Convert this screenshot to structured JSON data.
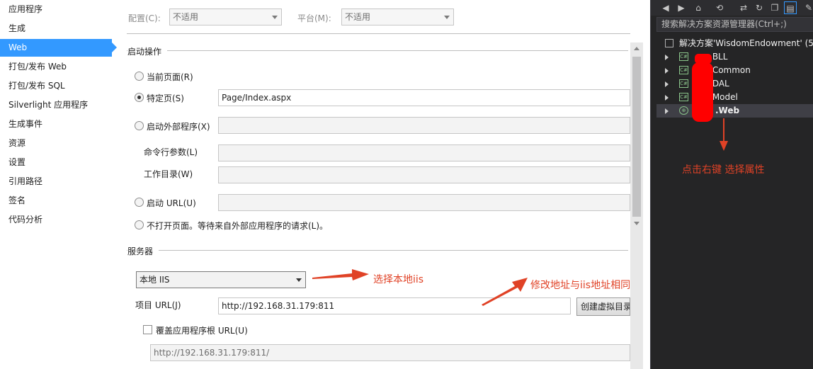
{
  "nav": {
    "items": [
      "应用程序",
      "生成",
      "Web",
      "打包/发布 Web",
      "打包/发布 SQL",
      "Silverlight 应用程序",
      "生成事件",
      "资源",
      "设置",
      "引用路径",
      "签名",
      "代码分析"
    ],
    "active_index": 2
  },
  "config_bar": {
    "config_label": "配置(C):",
    "config_value": "不适用",
    "platform_label": "平台(M):",
    "platform_value": "不适用"
  },
  "start_action": {
    "title": "启动操作",
    "current_page_label": "当前页面(R)",
    "specific_page_label": "特定页(S)",
    "specific_page_value": "Page/Index.aspx",
    "external_program_label": "启动外部程序(X)",
    "cmd_args_label": "命令行参数(L)",
    "working_dir_label": "工作目录(W)",
    "start_url_label": "启动 URL(U)",
    "no_open_label": "不打开页面。等待来自外部应用程序的请求(L)。"
  },
  "servers": {
    "title": "服务器",
    "server_select_value": "本地 IIS",
    "project_url_label": "项目 URL(J)",
    "project_url_value": "http://192.168.31.179:811",
    "create_vdir_button": "创建虚拟目录",
    "override_root_label": "覆盖应用程序根 URL(U)",
    "override_root_value": "http://192.168.31.179:811/"
  },
  "solution_explorer": {
    "search_placeholder": "搜索解决方案资源管理器(Ctrl+;)",
    "solution_label": "解决方案'WisdomEndowment' (5",
    "projects": [
      ".BLL",
      ".Common",
      ".DAL",
      ".Model",
      ".Web"
    ],
    "selected_project": ".Web"
  },
  "annotations": {
    "right_click_note": "点击右键 选择属性",
    "select_local_iis_note": "选择本地iis",
    "modify_url_note": "修改地址与iis地址相同"
  },
  "colors": {
    "nav_active": "#3399ff",
    "annotation_red": "#e04226",
    "vs_dark": "#252526"
  }
}
